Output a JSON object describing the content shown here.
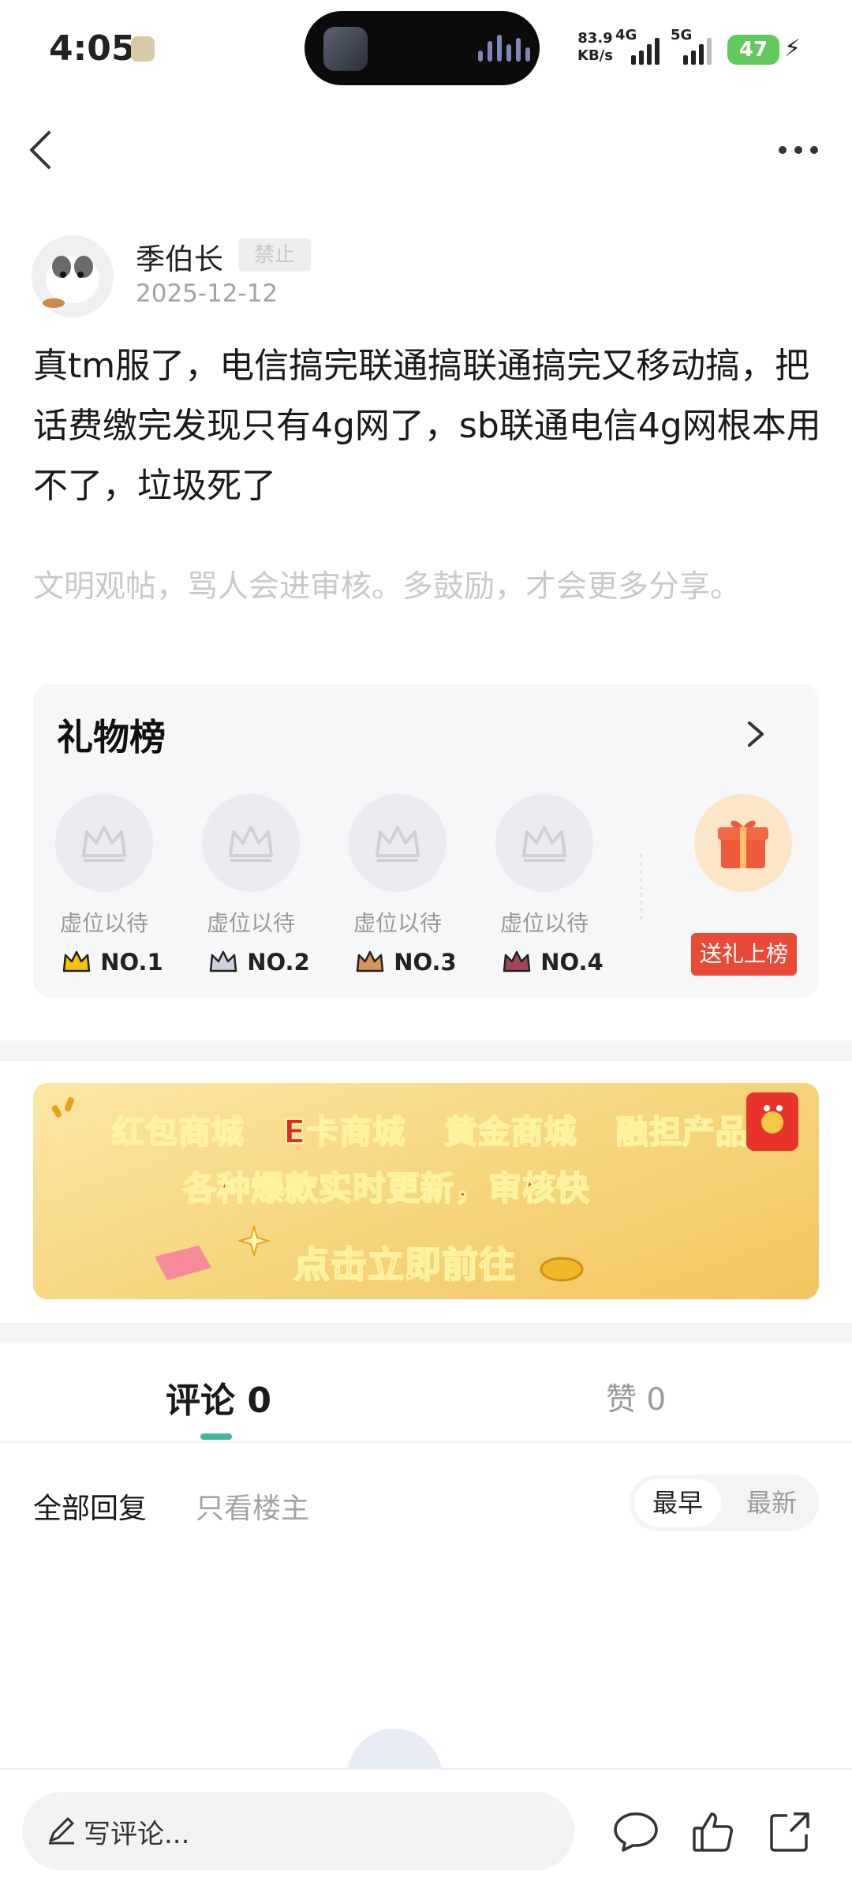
{
  "status_bar": {
    "time": "4:05",
    "net_speed_value": "83.9",
    "net_speed_unit": "KB/s",
    "signal1_label": "4G",
    "signal2_label": "5G",
    "battery": "47"
  },
  "post": {
    "author": "季伯长",
    "badge": "禁止",
    "date": "2025-12-12",
    "body": "真tm服了，电信搞完联通搞联通搞完又移动搞，把话费缴完发现只有4g网了，sb联通电信4g网根本用不了，垃圾死了",
    "civility_notice": "文明观帖，骂人会进审核。多鼓励，才会更多分享。"
  },
  "gift_board": {
    "title": "礼物榜",
    "slots": [
      {
        "wait": "虚位以待",
        "rank": "NO.1",
        "crown_color": "#f5c400"
      },
      {
        "wait": "虚位以待",
        "rank": "NO.2",
        "crown_color": "#c9d2dc"
      },
      {
        "wait": "虚位以待",
        "rank": "NO.3",
        "crown_color": "#d6965b"
      },
      {
        "wait": "虚位以待",
        "rank": "NO.4",
        "crown_color": "#a2465a"
      }
    ],
    "send_label": "送礼上榜"
  },
  "banner": {
    "row1": "红包商城 E卡商城 黄金商城 融担产品",
    "row2": "各种爆款实时更新，审核快",
    "row3": "点击立即前往"
  },
  "tabs": {
    "comments_label": "评论 0",
    "likes_label": "赞 0"
  },
  "filters": {
    "all": "全部回复",
    "owner_only": "只看楼主",
    "sort_earliest": "最早",
    "sort_latest": "最新"
  },
  "bottom_bar": {
    "placeholder": "写评论..."
  },
  "colors": {
    "accent": "#3fb99e",
    "send_button": "#e84a37",
    "banner_text": "#e2282b"
  }
}
